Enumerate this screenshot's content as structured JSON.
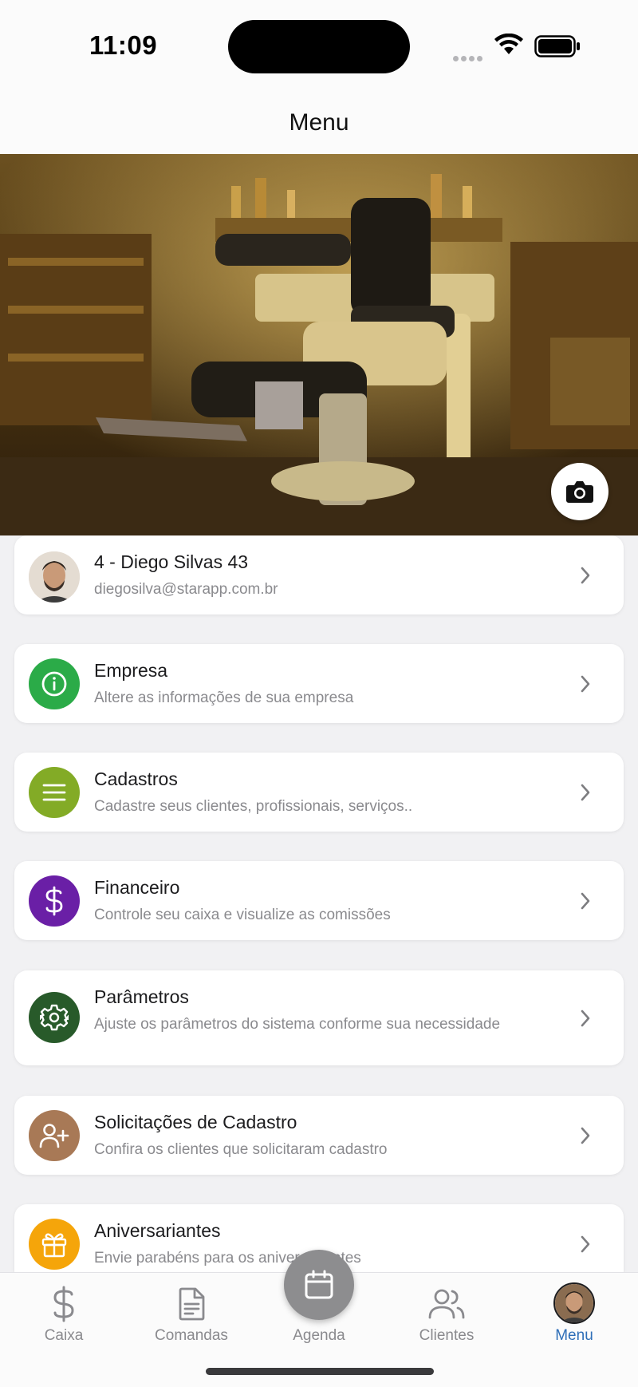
{
  "status_bar": {
    "time": "11:09"
  },
  "header": {
    "title": "Menu"
  },
  "profile": {
    "name": "4 - Diego Silvas 43",
    "email": "diegosilva@starapp.com.br"
  },
  "menu_items": [
    {
      "title": "Empresa",
      "subtitle": "Altere as informações de sua empresa",
      "icon": "info-icon",
      "color": "#2bab48"
    },
    {
      "title": "Cadastros",
      "subtitle": "Cadastre seus clientes, profissionais, serviços..",
      "icon": "list-icon",
      "color": "#83ab26"
    },
    {
      "title": "Financeiro",
      "subtitle": "Controle seu caixa e visualize as comissões",
      "icon": "dollar-icon",
      "color": "#6a1fa6"
    },
    {
      "title": "Parâmetros",
      "subtitle": "Ajuste os parâmetros do sistema conforme sua necessidade",
      "icon": "gear-icon",
      "color": "#285a2a"
    },
    {
      "title": "Solicitações de Cadastro",
      "subtitle": "Confira os clientes que solicitaram cadastro",
      "icon": "add-user-icon",
      "color": "#a87956"
    },
    {
      "title": "Aniversariantes",
      "subtitle": "Envie parabéns para os aniversariantes",
      "icon": "gift-icon",
      "color": "#f5a50a"
    }
  ],
  "tab_bar": {
    "tabs": [
      {
        "label": "Caixa",
        "icon": "dollar-icon"
      },
      {
        "label": "Comandas",
        "icon": "document-icon"
      },
      {
        "label": "Agenda",
        "icon": "calendar-icon"
      },
      {
        "label": "Clientes",
        "icon": "users-icon"
      },
      {
        "label": "Menu",
        "icon": "avatar"
      }
    ],
    "active": "Menu",
    "active_color": "#2f6fb8"
  }
}
